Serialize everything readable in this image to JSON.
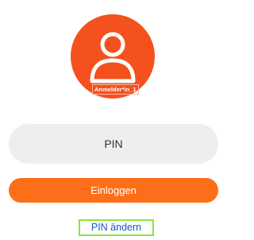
{
  "profile": {
    "user_label": "Anmelder*in_1",
    "icon": "user-icon"
  },
  "login": {
    "pin_placeholder": "PIN",
    "login_button_label": "Einloggen",
    "change_pin_label": "PIN ändern"
  },
  "colors": {
    "avatar_background": "#f4511e",
    "login_button": "#fd6e1a",
    "pin_field_background": "#eeeeee",
    "link_text": "#1a56c4",
    "focus_highlight": "#86e63a"
  }
}
